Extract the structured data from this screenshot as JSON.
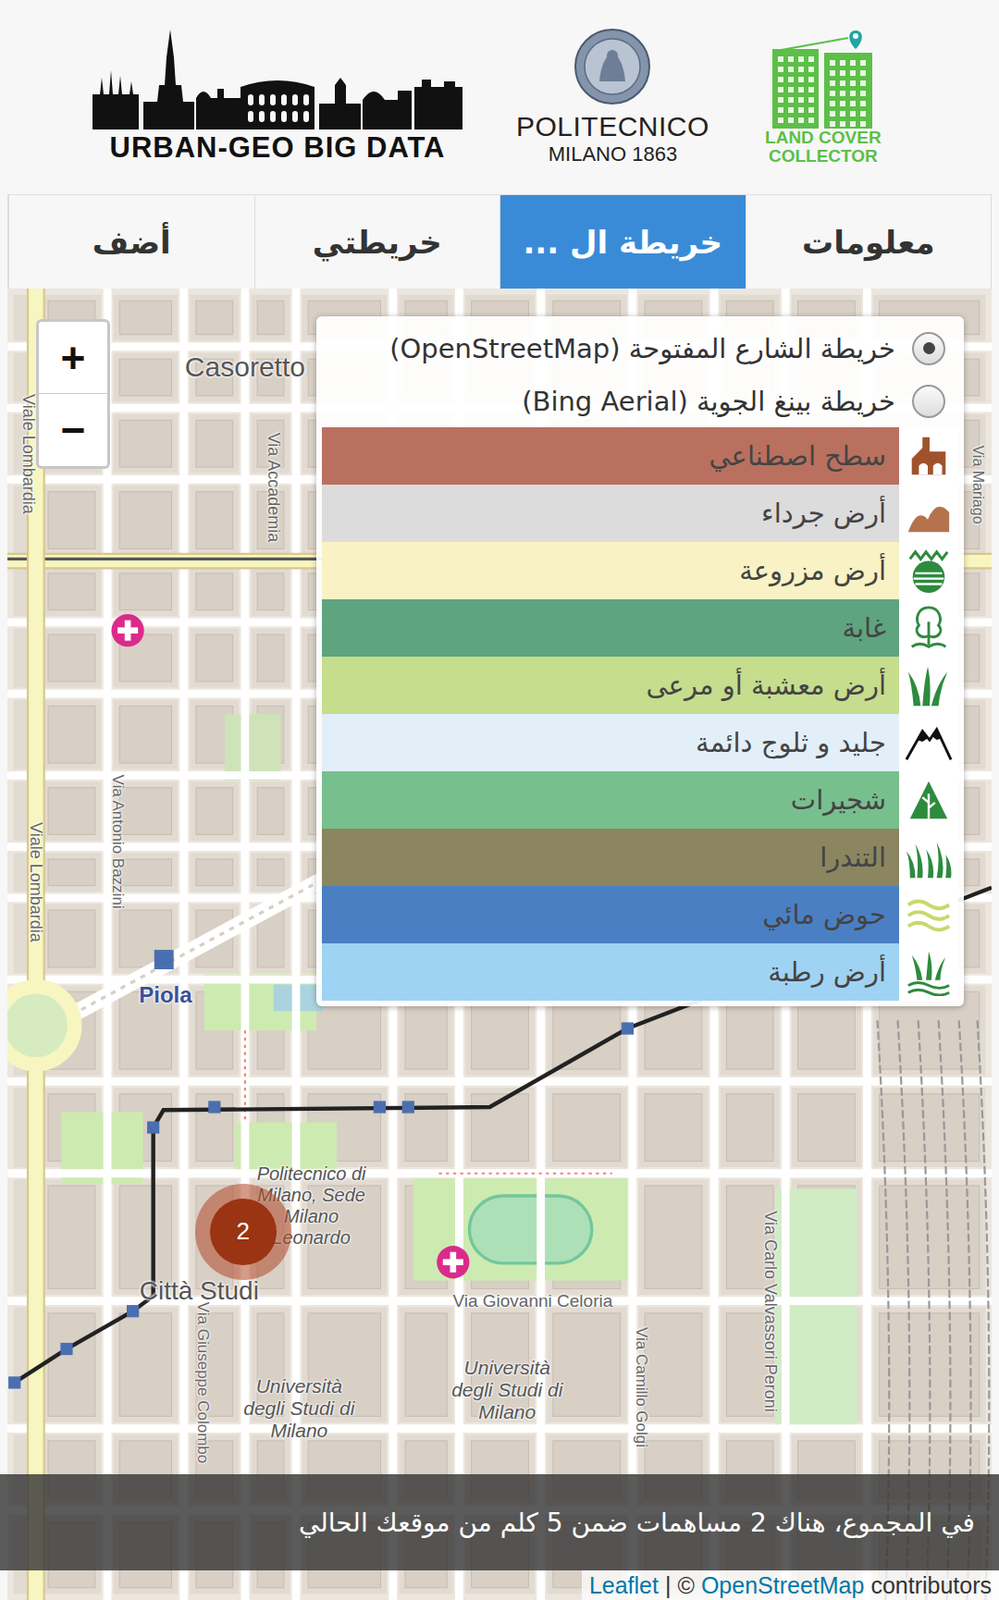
{
  "header": {
    "urban": "URBAN-GEO BIG DATA",
    "polimi": {
      "name": "POLITECNICO",
      "subtitle": "MILANO 1863"
    },
    "lcc": {
      "line1": "LAND COVER",
      "line2": "COLLECTOR"
    }
  },
  "tabs": [
    {
      "label": "معلومات",
      "selected": false
    },
    {
      "label": "خريطة ال ...",
      "selected": true
    },
    {
      "label": "خريطتي",
      "selected": false
    },
    {
      "label": "أضف",
      "selected": false
    }
  ],
  "zoom": {
    "in": "+",
    "out": "−"
  },
  "layers": {
    "base": [
      {
        "label": "خريطة الشارع المفتوحة (OpenStreetMap)",
        "selected": true
      },
      {
        "label": "خريطة بينغ الجوية (Bing Aerial)",
        "selected": false
      }
    ],
    "legend": [
      {
        "label": "سطح اصطناعي",
        "color": "#b9705f"
      },
      {
        "label": "أرض جرداء",
        "color": "#dcdcdc"
      },
      {
        "label": "أرض مزروعة",
        "color": "#f8f2c4"
      },
      {
        "label": "غابة",
        "color": "#5ea47f"
      },
      {
        "label": "أرض معشبة أو مرعى",
        "color": "#c5dd8c"
      },
      {
        "label": "جليد و ثلوج دائمة",
        "color": "#e2eff8"
      },
      {
        "label": "شجيرات",
        "color": "#78bf8e"
      },
      {
        "label": "التندرا",
        "color": "#8b8660"
      },
      {
        "label": "حوض مائي",
        "color": "#4b7fc3"
      },
      {
        "label": "أرض رطبة",
        "color": "#9fd3f3"
      }
    ]
  },
  "map_labels": [
    "Casoretto",
    "Viale Lombardia",
    "Via Accademia",
    "Via Antonio Bazzini",
    "Viale Lombardia",
    "Piola",
    "Politecnico di Milano, Sede Milano Leonardo",
    "Città Studi",
    "Via Giovanni Celoria",
    "Università degli Studi di Milano",
    "Università degli Studi di Milano",
    "Via Giuseppe Colombo",
    "Via Camillo Golgi",
    "Via Carlo Valvassori Peroni",
    "Via Mariago"
  ],
  "cluster": {
    "count": "2"
  },
  "status": "في المجموع، هناك 2 مساهمات ضمن 5 كلم من موقعك الحالي",
  "attribution": {
    "leaflet": "Leaflet",
    "separator": "|",
    "copyright": "©",
    "osm": "OpenStreetMap",
    "suffix": "contributors"
  }
}
